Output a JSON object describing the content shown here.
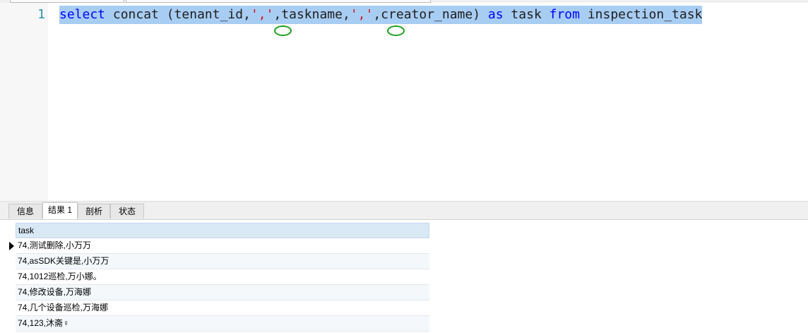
{
  "editor": {
    "line_number": "1",
    "code": {
      "select": "select",
      "p1": " concat (tenant_id,",
      "s1": "','",
      "p2": ",taskname,",
      "s2": "','",
      "p3": ",creator_name) ",
      "as": "as",
      "p4": " task ",
      "from": "from",
      "p5": " inspection_task"
    }
  },
  "tabs": [
    "信息",
    "结果 1",
    "剖析",
    "状态"
  ],
  "results": {
    "column": "task",
    "rows": [
      "74,测试删除,小万万",
      "74,asSDK关键是,小万万",
      "74,1012巡检,万小娜。",
      "74,修改设备,万海娜",
      "74,几个设备巡检,万海娜",
      "74,123,沐斋♀"
    ]
  },
  "colors": {
    "keyword": "#0000ff",
    "string": "#d4101f",
    "selection": "#a8cdf3",
    "annotation_circle": "#1aa11a"
  }
}
